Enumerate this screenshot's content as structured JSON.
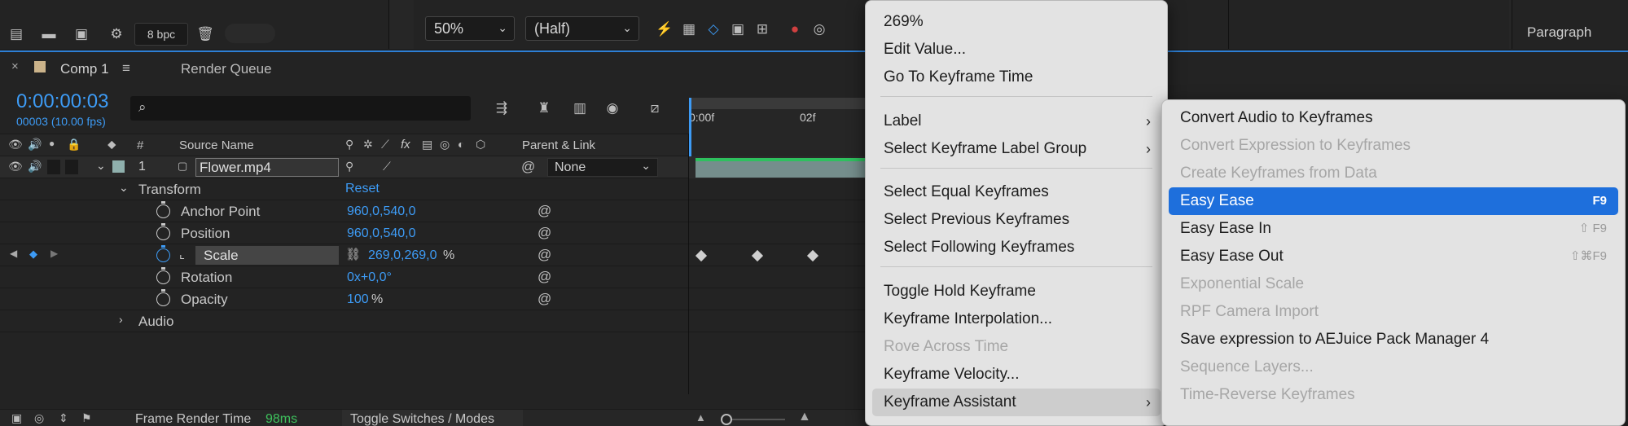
{
  "project_toolbar": {
    "bpc_label": "8 bpc"
  },
  "viewer_toolbar": {
    "zoom_value": "50%",
    "resolution_value": "(Half)"
  },
  "paragraph_panel": {
    "title": "Paragraph"
  },
  "timeline": {
    "tab_label": "Comp 1",
    "render_queue_tab": "Render Queue",
    "timecode": "0:00:00:03",
    "frame_info": "00003 (10.00 fps)",
    "search_placeholder": "",
    "headers": {
      "num": "#",
      "source_name": "Source Name",
      "parent_link": "Parent & Link",
      "fx": "fx"
    },
    "ruler": {
      "tick_0": "0:00f",
      "tick_1": "02f"
    },
    "layer": {
      "number": "1",
      "name": "Flower.mp4",
      "parent": "None"
    },
    "transform": {
      "label": "Transform",
      "reset": "Reset",
      "properties": [
        {
          "name": "Anchor Point",
          "value": "960,0,540,0",
          "suffix": ""
        },
        {
          "name": "Position",
          "value": "960,0,540,0",
          "suffix": ""
        },
        {
          "name": "Scale",
          "value": "269,0,269,0",
          "suffix": "%"
        },
        {
          "name": "Rotation",
          "value": "0x+0,0°",
          "suffix": ""
        },
        {
          "name": "Opacity",
          "value": "100",
          "suffix": "%"
        }
      ]
    },
    "audio_label": "Audio",
    "footer": {
      "frame_render_label": "Frame Render Time",
      "frame_render_value": "98ms",
      "toggle_label": "Toggle Switches / Modes"
    }
  },
  "context_menu": {
    "items": [
      {
        "label": "269%",
        "disabled": false
      },
      {
        "label": "Edit Value...",
        "disabled": false
      },
      {
        "label": "Go To Keyframe Time",
        "disabled": false
      },
      {
        "label": "Label",
        "disabled": false,
        "submenu": true
      },
      {
        "label": "Select Keyframe Label Group",
        "disabled": false,
        "submenu": true
      },
      {
        "label": "Select Equal Keyframes",
        "disabled": false
      },
      {
        "label": "Select Previous Keyframes",
        "disabled": false
      },
      {
        "label": "Select Following Keyframes",
        "disabled": false
      },
      {
        "label": "Toggle Hold Keyframe",
        "disabled": false
      },
      {
        "label": "Keyframe Interpolation...",
        "disabled": false
      },
      {
        "label": "Rove Across Time",
        "disabled": true
      },
      {
        "label": "Keyframe Velocity...",
        "disabled": false
      },
      {
        "label": "Keyframe Assistant",
        "disabled": false,
        "submenu": true,
        "hovered": true
      }
    ]
  },
  "submenu": {
    "items": [
      {
        "label": "Convert Audio to Keyframes",
        "disabled": false,
        "shortcut": ""
      },
      {
        "label": "Convert Expression to Keyframes",
        "disabled": true,
        "shortcut": ""
      },
      {
        "label": "Create Keyframes from Data",
        "disabled": true,
        "shortcut": ""
      },
      {
        "label": "Easy Ease",
        "disabled": false,
        "shortcut": "F9",
        "active": true
      },
      {
        "label": "Easy Ease In",
        "disabled": false,
        "shortcut": "⇧ F9"
      },
      {
        "label": "Easy Ease Out",
        "disabled": false,
        "shortcut": "⇧⌘F9"
      },
      {
        "label": "Exponential Scale",
        "disabled": true,
        "shortcut": ""
      },
      {
        "label": "RPF Camera Import",
        "disabled": true,
        "shortcut": ""
      },
      {
        "label": "Save expression to AEJuice Pack Manager 4",
        "disabled": false,
        "shortcut": ""
      },
      {
        "label": "Sequence Layers...",
        "disabled": true,
        "shortcut": ""
      },
      {
        "label": "Time-Reverse Keyframes",
        "disabled": true,
        "shortcut": ""
      }
    ]
  },
  "colors": {
    "accent_blue": "#3d9bf5",
    "menu_highlight": "#1e6fdc",
    "layer_bar": "#8fb0ad"
  }
}
